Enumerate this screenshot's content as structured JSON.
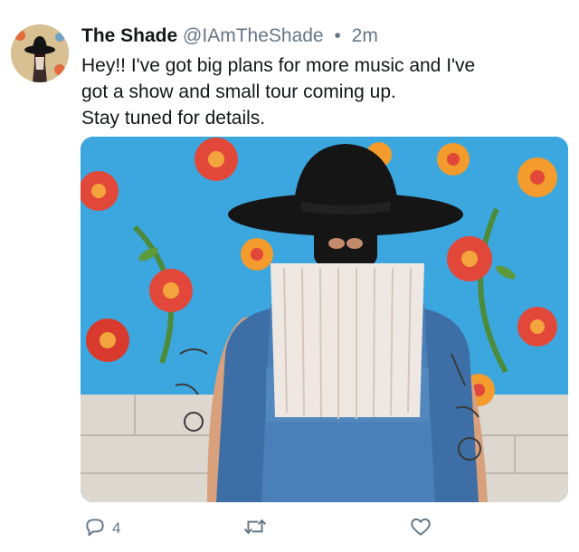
{
  "user": {
    "display_name": "The Shade",
    "handle": "@IAmTheShade",
    "separator": "•",
    "time": "2m"
  },
  "tweet": {
    "lines": [
      "Hey!! I've got big plans for more music and I've",
      "got a show and small tour coming up.",
      "Stay tuned for details."
    ]
  },
  "actions": {
    "reply_count": "4"
  },
  "colors": {
    "text": "#14171a",
    "secondary": "#657786",
    "backdrop": "#3ba7de"
  },
  "icons": {
    "reply": "reply-icon",
    "retweet": "retweet-icon",
    "like": "heart-icon"
  }
}
